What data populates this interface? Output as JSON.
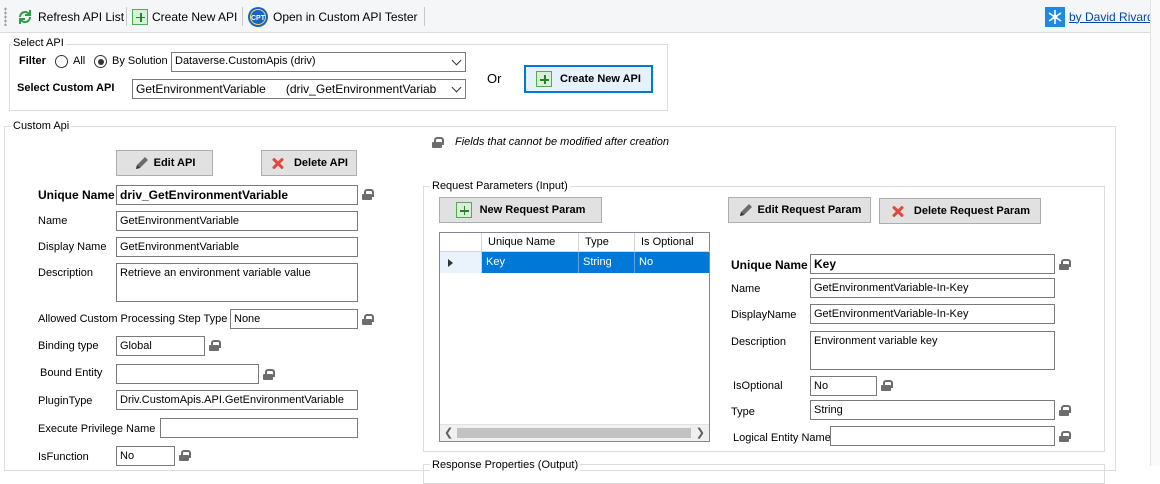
{
  "toolbar": {
    "refresh_label": "Refresh API List",
    "create_label": "Create New API",
    "tester_label": "Open in Custom API Tester",
    "tester_icon_text": "CPT",
    "author_link": "by David Rivard"
  },
  "select_api": {
    "group_label": "Select API",
    "filter_label": "Filter",
    "all_label": "All",
    "by_solution_label": "By Solution",
    "solution_value": "Dataverse.CustomApis (driv)",
    "select_label": "Select Custom API",
    "custom_api_value": "GetEnvironmentVariable      (driv_GetEnvironmentVariab",
    "or_label": "Or",
    "create_button": "Create New API"
  },
  "custom_api": {
    "group_label": "Custom Api",
    "lock_note": "Fields that cannot be modified after creation",
    "edit_button": "Edit API",
    "delete_button": "Delete API",
    "unique_name_label": "Unique Name",
    "unique_name_value": "driv_GetEnvironmentVariable",
    "name_label": "Name",
    "name_value": "GetEnvironmentVariable",
    "display_name_label": "Display Name",
    "display_name_value": "GetEnvironmentVariable",
    "description_label": "Description",
    "description_value": "Retrieve an environment variable value",
    "allowed_step_label": "Allowed Custom Processing Step Type",
    "allowed_step_value": "None",
    "binding_type_label": "Binding type",
    "binding_type_value": "Global",
    "bound_entity_label": "Bound Entity",
    "bound_entity_value": "",
    "plugin_type_label": "PluginType",
    "plugin_type_value": "Driv.CustomApis.API.GetEnvironmentVariable",
    "execute_priv_label": "Execute Privilege Name",
    "execute_priv_value": "",
    "is_function_label": "IsFunction",
    "is_function_value": "No"
  },
  "request_params": {
    "group_label": "Request Parameters (Input)",
    "new_button": "New Request Param",
    "edit_button": "Edit Request Param",
    "delete_button": "Delete Request Param",
    "columns": [
      "Unique Name",
      "Type",
      "Is Optional"
    ],
    "rows": [
      [
        "Key",
        "String",
        "No"
      ]
    ],
    "unique_name_label": "Unique Name",
    "unique_name_value": "Key",
    "name_label": "Name",
    "name_value": "GetEnvironmentVariable-In-Key",
    "display_name_label": "DisplayName",
    "display_name_value": "GetEnvironmentVariable-In-Key",
    "description_label": "Description",
    "description_value": "Environment variable key",
    "is_optional_label": "IsOptional",
    "is_optional_value": "No",
    "type_label": "Type",
    "type_value": "String",
    "logical_entity_label": "Logical Entity Name",
    "logical_entity_value": ""
  },
  "response_props": {
    "group_label": "Response Properties (Output)"
  }
}
